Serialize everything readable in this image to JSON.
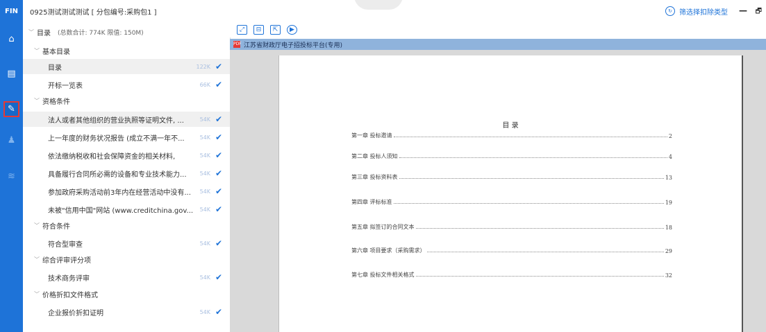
{
  "app": {
    "logo": "FIN",
    "title": "0925测试测试测试 [ 分包编号:采购包1 ]",
    "filter_label": "筛选择扣除类型",
    "minimize_label": "—",
    "restore_label": "🗗"
  },
  "rail": [
    {
      "name": "home-icon",
      "glyph": "⌂"
    },
    {
      "name": "document-icon",
      "glyph": "▤"
    },
    {
      "name": "edit-icon",
      "glyph": "✎"
    },
    {
      "name": "stamp-icon",
      "glyph": "♟"
    },
    {
      "name": "layers-icon",
      "glyph": "≋"
    }
  ],
  "tree": {
    "root_label": "目录",
    "root_sub": "(总数合计: 774K 限值: 150M)",
    "sections": [
      {
        "label": "基本目录",
        "items": [
          {
            "label": "目录",
            "size": "122K",
            "selected": true
          },
          {
            "label": "开标一览表",
            "size": "66K",
            "selected": false
          }
        ]
      },
      {
        "label": "资格条件",
        "items": [
          {
            "label": "法人或者其他组织的营业执照等证明文件, ...",
            "size": "54K",
            "selected": false
          },
          {
            "label": "上一年度的财务状况报告 (成立不满一年不...",
            "size": "54K",
            "selected": false
          },
          {
            "label": "依法缴纳税收和社会保障资金的相关材料,",
            "size": "54K",
            "selected": false
          },
          {
            "label": "具备履行合同所必需的设备和专业技术能力...",
            "size": "54K",
            "selected": false
          },
          {
            "label": "参加政府采购活动前3年内在经营活动中没有...",
            "size": "54K",
            "selected": false
          },
          {
            "label": "未被\"信用中国\"网站 (www.creditchina.gov...",
            "size": "54K",
            "selected": false
          }
        ]
      },
      {
        "label": "符合条件",
        "items": [
          {
            "label": "符合型审查",
            "size": "54K",
            "selected": false
          }
        ]
      },
      {
        "label": "综合评审评分项",
        "items": [
          {
            "label": "技术商务评审",
            "size": "54K",
            "selected": false
          }
        ]
      },
      {
        "label": "价格折扣文件格式",
        "items": [
          {
            "label": "企业报价折扣证明",
            "size": "54K",
            "selected": false
          }
        ]
      }
    ]
  },
  "toolbar": [
    {
      "name": "zoom-fit-button",
      "glyph": "⤢"
    },
    {
      "name": "page-view-button",
      "glyph": "⊟"
    },
    {
      "name": "export-button",
      "glyph": "⇱"
    },
    {
      "name": "play-button",
      "glyph": "▶"
    }
  ],
  "document": {
    "tab_name": "江苏省财政厅电子招投标平台(专用)",
    "pdf_badge": "PDF",
    "toc_title": "目 录",
    "toc": [
      {
        "title": "第一章  投标邀请",
        "page": "2"
      },
      {
        "title": "第二章  投标人须知",
        "page": "4"
      },
      {
        "title": "第三章  投标资料表",
        "page": "13"
      },
      {
        "title": "第四章  评标标准",
        "page": "19"
      },
      {
        "title": "第五章  拟签订的合同文本",
        "page": "18"
      },
      {
        "title": "第六章  项目要求（采购需求）",
        "page": "29"
      },
      {
        "title": "第七章  投标文件相关格式",
        "page": "32"
      }
    ]
  },
  "check_glyph": "✔",
  "chevron_glyph": "﹀"
}
